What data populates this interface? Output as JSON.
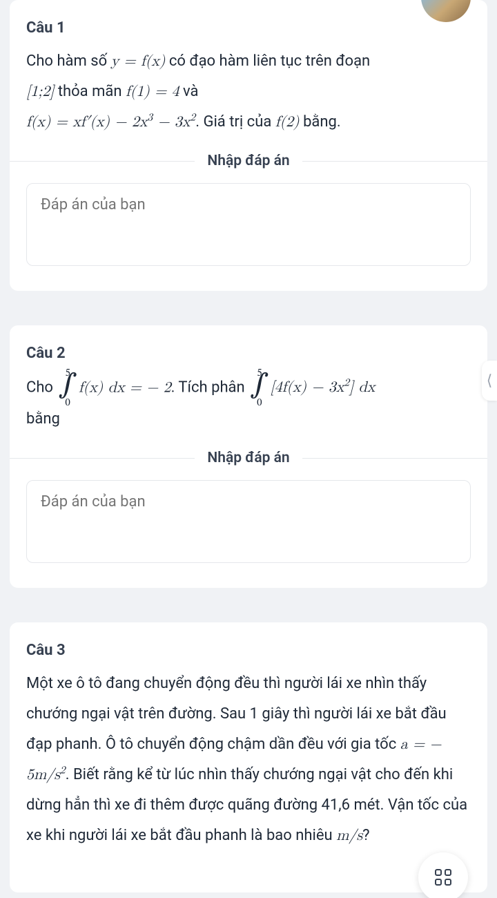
{
  "questions": [
    {
      "title": "Câu 1",
      "part1": "Cho hàm số ",
      "eq1": "y = f(x)",
      "part2": " có đạo hàm liên tục trên đoạn ",
      "eq2": "[1;2]",
      "part3": " thỏa mãn ",
      "eq3": "f(1) = 4",
      "part4": " và",
      "eq4": "f(x) = xf′(x) − 2x",
      "eq4_exp1": "3",
      "eq4_mid": " − 3x",
      "eq4_exp2": "2",
      "part5": ". Giá trị của ",
      "eq5": "f(2)",
      "part6": " bằng."
    },
    {
      "title": "Câu 2",
      "part1": "Cho ",
      "int1_up": "5",
      "int1_lo": "0",
      "eq1": "f(x) dx = − 2",
      "part2": ". Tích phân ",
      "int2_up": "5",
      "int2_lo": "0",
      "eq2a": "[4f(x) − 3x",
      "eq2_exp": "2",
      "eq2b": "] dx",
      "part3": "bằng"
    },
    {
      "title": "Câu 3",
      "part1": "Một xe ô tô đang chuyển động đều thì người lái xe nhìn thấy chướng ngại vật trên đường. Sau 1 giây thì người lái xe bắt đầu đạp phanh. Ô tô chuyển động chậm dần đều với gia tốc ",
      "eq1a": "a = −  5m/s",
      "eq1_exp": "2",
      "part2": ". Biết rằng kể từ lúc nhìn thấy chướng ngại vật cho đến khi dừng hẳn thì xe đi thêm được quãng đường 41,6 mét. Vận tốc của xe khi người lái xe bắt đầu phanh là bao nhiêu ",
      "eq2": "m/s",
      "part3": "?"
    }
  ],
  "divider_label": "Nhập đáp án",
  "answer_placeholder": "Đáp án của bạn",
  "side_tab_glyph": "⟨"
}
